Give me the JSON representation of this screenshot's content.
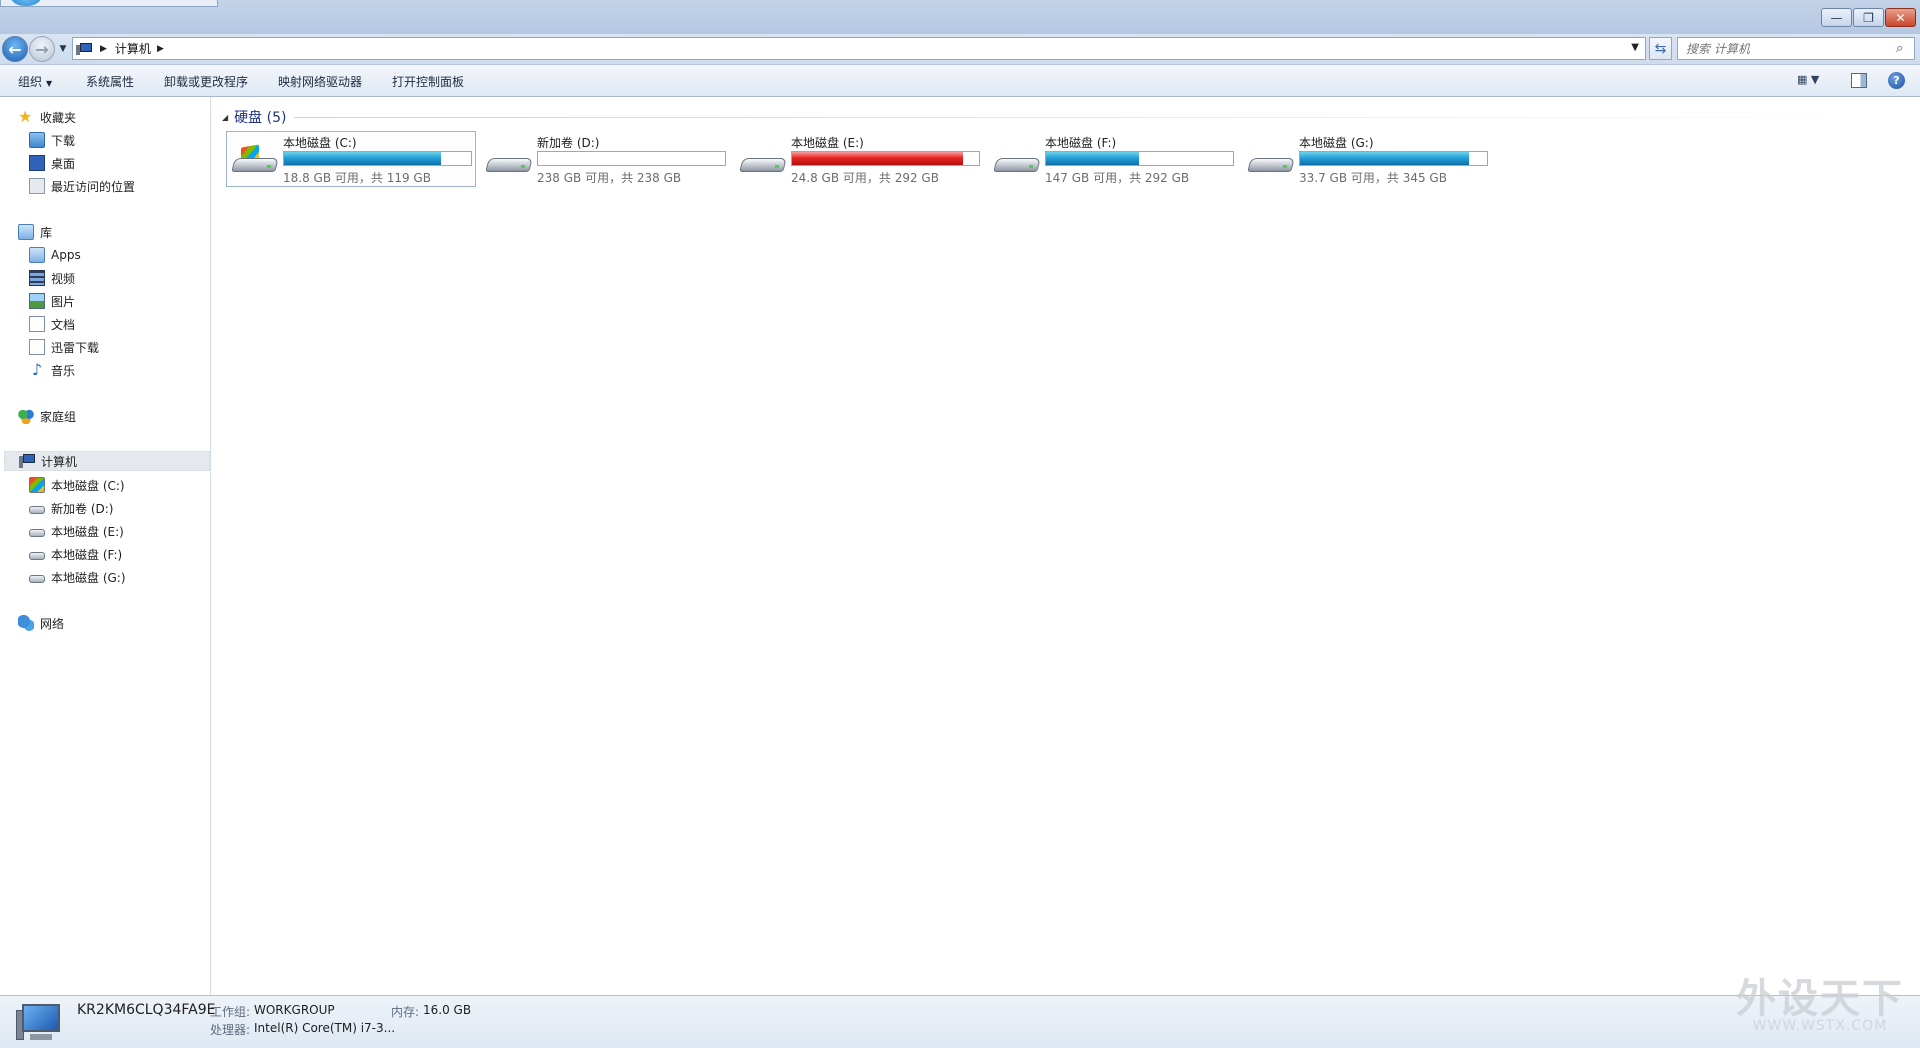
{
  "window": {
    "minimize_glyph": "—",
    "restore_glyph": "❐",
    "close_glyph": "✕"
  },
  "address": {
    "back_glyph": "←",
    "forward_glyph": "→",
    "crumb": "计算机",
    "search_placeholder": "搜索 计算机"
  },
  "toolbar": {
    "organize": "组织",
    "system_properties": "系统属性",
    "uninstall": "卸载或更改程序",
    "map_drive": "映射网络驱动器",
    "control_panel": "打开控制面板"
  },
  "sidebar": {
    "favorites": {
      "label": "收藏夹",
      "items": [
        {
          "label": "下载",
          "icon": "downloads-folder-icon"
        },
        {
          "label": "桌面",
          "icon": "desktop-icon"
        },
        {
          "label": "最近访问的位置",
          "icon": "recent-places-icon"
        }
      ]
    },
    "libraries": {
      "label": "库",
      "items": [
        {
          "label": "Apps",
          "icon": "apps-library-icon"
        },
        {
          "label": "视频",
          "icon": "video-icon"
        },
        {
          "label": "图片",
          "icon": "pictures-icon"
        },
        {
          "label": "文档",
          "icon": "documents-icon"
        },
        {
          "label": "迅雷下载",
          "icon": "thunder-download-icon"
        },
        {
          "label": "音乐",
          "icon": "music-icon"
        }
      ]
    },
    "homegroup": {
      "label": "家庭组"
    },
    "computer": {
      "label": "计算机",
      "items": [
        {
          "label": "本地磁盘 (C:)"
        },
        {
          "label": "新加卷 (D:)"
        },
        {
          "label": "本地磁盘 (E:)"
        },
        {
          "label": "本地磁盘 (F:)"
        },
        {
          "label": "本地磁盘 (G:)"
        }
      ]
    },
    "network": {
      "label": "网络"
    }
  },
  "main": {
    "group_title": "硬盘 (5)",
    "drives": [
      {
        "name": "本地磁盘 (C:)",
        "free_text": "18.8 GB 可用，共 119 GB",
        "used_fraction": 0.842,
        "warn": false
      },
      {
        "name": "新加卷 (D:)",
        "free_text": "238 GB 可用，共 238 GB",
        "used_fraction": 0.0,
        "warn": false
      },
      {
        "name": "本地磁盘 (E:)",
        "free_text": "24.8 GB 可用，共 292 GB",
        "used_fraction": 0.915,
        "warn": true
      },
      {
        "name": "本地磁盘 (F:)",
        "free_text": "147 GB 可用，共 292 GB",
        "used_fraction": 0.497,
        "warn": false
      },
      {
        "name": "本地磁盘 (G:)",
        "free_text": "33.7 GB 可用，共 345 GB",
        "used_fraction": 0.902,
        "warn": false
      }
    ]
  },
  "details": {
    "computer_name": "KR2KM6CLQ34FA9E",
    "workgroup_label": "工作组:",
    "workgroup_value": "WORKGROUP",
    "memory_label": "内存:",
    "memory_value": "16.0 GB",
    "processor_label": "处理器:",
    "processor_value": "Intel(R) Core(TM) i7-3..."
  },
  "watermark": {
    "cn": "外设天下",
    "url": "WWW.WSTX.COM"
  }
}
